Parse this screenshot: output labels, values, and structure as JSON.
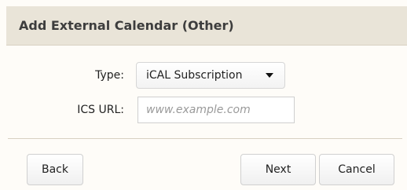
{
  "dialog": {
    "title": "Add External Calendar (Other)"
  },
  "form": {
    "type_label": "Type:",
    "type_value": "iCAL Subscription",
    "url_label": "ICS URL:",
    "url_value": "",
    "url_placeholder": "www.example.com"
  },
  "buttons": {
    "back": "Back",
    "next": "Next",
    "cancel": "Cancel"
  },
  "icons": {
    "select_caret": "chevron-down-icon"
  }
}
